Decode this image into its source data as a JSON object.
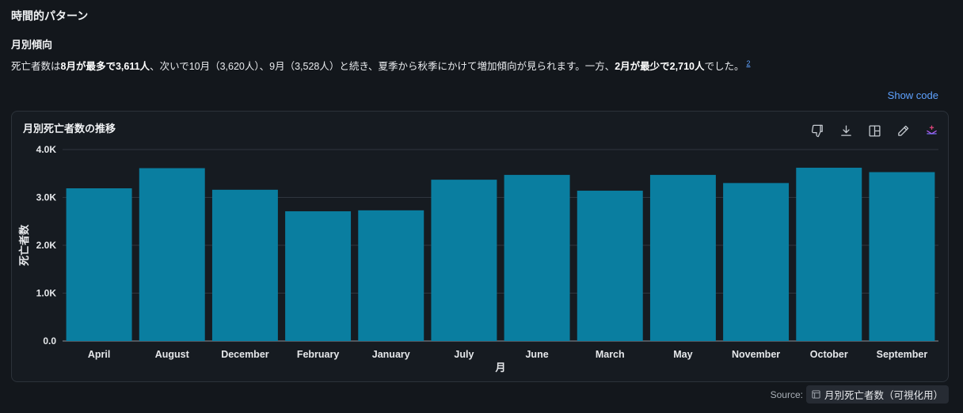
{
  "section_title": "時間的パターン",
  "sub_title": "月別傾向",
  "summary": {
    "p1": "死亡者数は",
    "b1": "8月が最多で3,611人",
    "p2": "、次いで10月（3,620人）、9月（3,528人）と続き、夏季から秋季にかけて増加傾向が見られます。一方、",
    "b2": "2月が最少で2,710人",
    "p3": "でした。",
    "footnote": "2"
  },
  "show_code_label": "Show code",
  "toolbar_icons": [
    "thumbs-down-icon",
    "download-icon",
    "layout-icon",
    "edit-icon",
    "sparkle-icon"
  ],
  "source": {
    "label": "Source:",
    "name": "月別死亡者数（可視化用）"
  },
  "colors": {
    "bar": "#0a7ea0",
    "link": "#5ea2ff"
  },
  "chart_data": {
    "type": "bar",
    "title": "月別死亡者数の推移",
    "xlabel": "月",
    "ylabel": "死亡者数",
    "categories": [
      "April",
      "August",
      "December",
      "February",
      "January",
      "July",
      "June",
      "March",
      "May",
      "November",
      "October",
      "September"
    ],
    "values": [
      3190,
      3611,
      3160,
      2710,
      2730,
      3370,
      3470,
      3140,
      3470,
      3300,
      3620,
      3528
    ],
    "ylim": [
      0,
      4000
    ],
    "yticks": [
      0,
      1000,
      2000,
      3000,
      4000
    ],
    "ytick_labels": [
      "0.0",
      "1.0K",
      "2.0K",
      "3.0K",
      "4.0K"
    ],
    "grid": true,
    "legend": "none"
  }
}
